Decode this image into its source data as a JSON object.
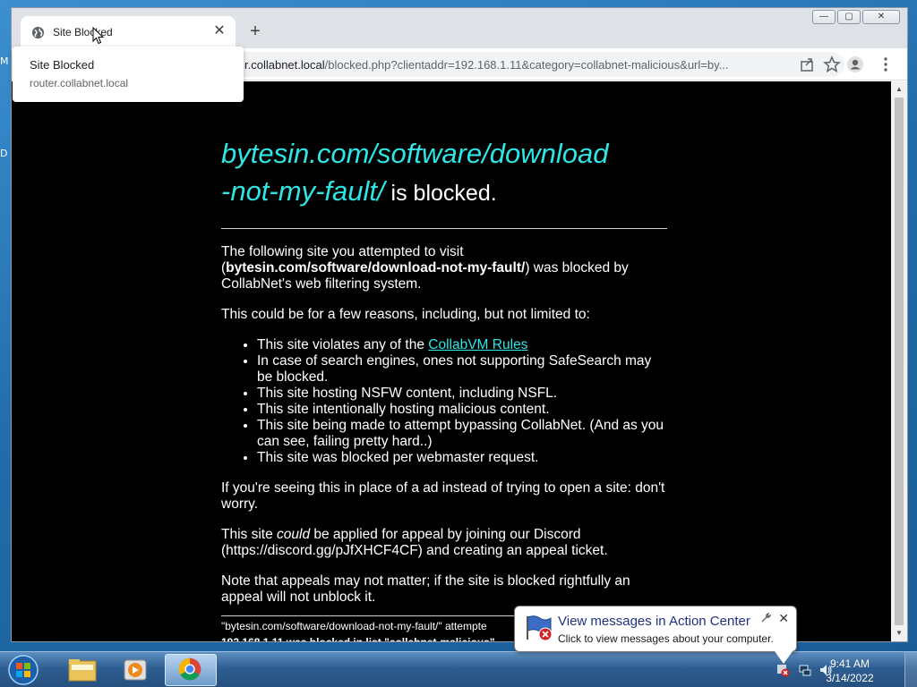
{
  "desktop": {
    "sliver_top": "M",
    "sliver_mid": "D"
  },
  "browser": {
    "tab": {
      "title": "Site Blocked"
    },
    "new_tab_label": "+",
    "window_controls": {
      "minimize": "—",
      "maximize": "▢",
      "close": "✕"
    },
    "address": {
      "prefix": "r.collabnet.local",
      "rest": "/blocked.php?clientaddr=192.168.1.11&category=collabnet-malicious&url=by..."
    },
    "hovercard": {
      "title": "Site Blocked",
      "subtitle": "router.collabnet.local"
    }
  },
  "page": {
    "headline_site_line1": "bytesin.com/software/download",
    "headline_site_line2": "-not-my-fault/",
    "headline_blocked": " is blocked.",
    "intro_1": "The following site you attempted to visit",
    "intro_bold": "bytesin.com/software/download-not-my-fault/",
    "intro_2": ") was blocked by CollabNet's web filtering system.",
    "reasons_intro": "This could be for a few reasons, including, but not limited to:",
    "reason_1_prefix": "This site violates any of the ",
    "reason_1_link": "CollabVM Rules",
    "reasons": [
      "In case of search engines, ones not supporting SafeSearch may be blocked.",
      "This site hosting NSFW content, including NSFL.",
      "This site intentionally hosting malicious content.",
      "This site being made to attempt bypassing CollabNet. (And as you can see, failing pretty hard..)",
      "This site was blocked per webmaster request."
    ],
    "ad_note": "If you're seeing this in place of a ad instead of trying to open a site: don't worry.",
    "appeal_1": "This site ",
    "appeal_em": "could",
    "appeal_2": " be applied for appeal by joining our Discord (https://discord.gg/pJfXHCF4CF) and creating an appeal ticket.",
    "appeal_note": "Note that appeals may not matter; if the site is blocked rightfully an appeal will not unblock it.",
    "footer_1": "\"bytesin.com/software/download-not-my-fault/\" attempte",
    "footer_2": "192.168.1.11 was blocked in list \"collabnet-malicious\""
  },
  "notification": {
    "title": "View messages in Action Center",
    "text": "Click to view messages about your computer.",
    "close": "✕"
  },
  "taskbar": {
    "time": "9:41 AM",
    "date": "3/14/2022"
  },
  "colors": {
    "link_cyan": "#2ee6e6",
    "page_bg": "#000000",
    "balloon_title": "#1e3287"
  }
}
